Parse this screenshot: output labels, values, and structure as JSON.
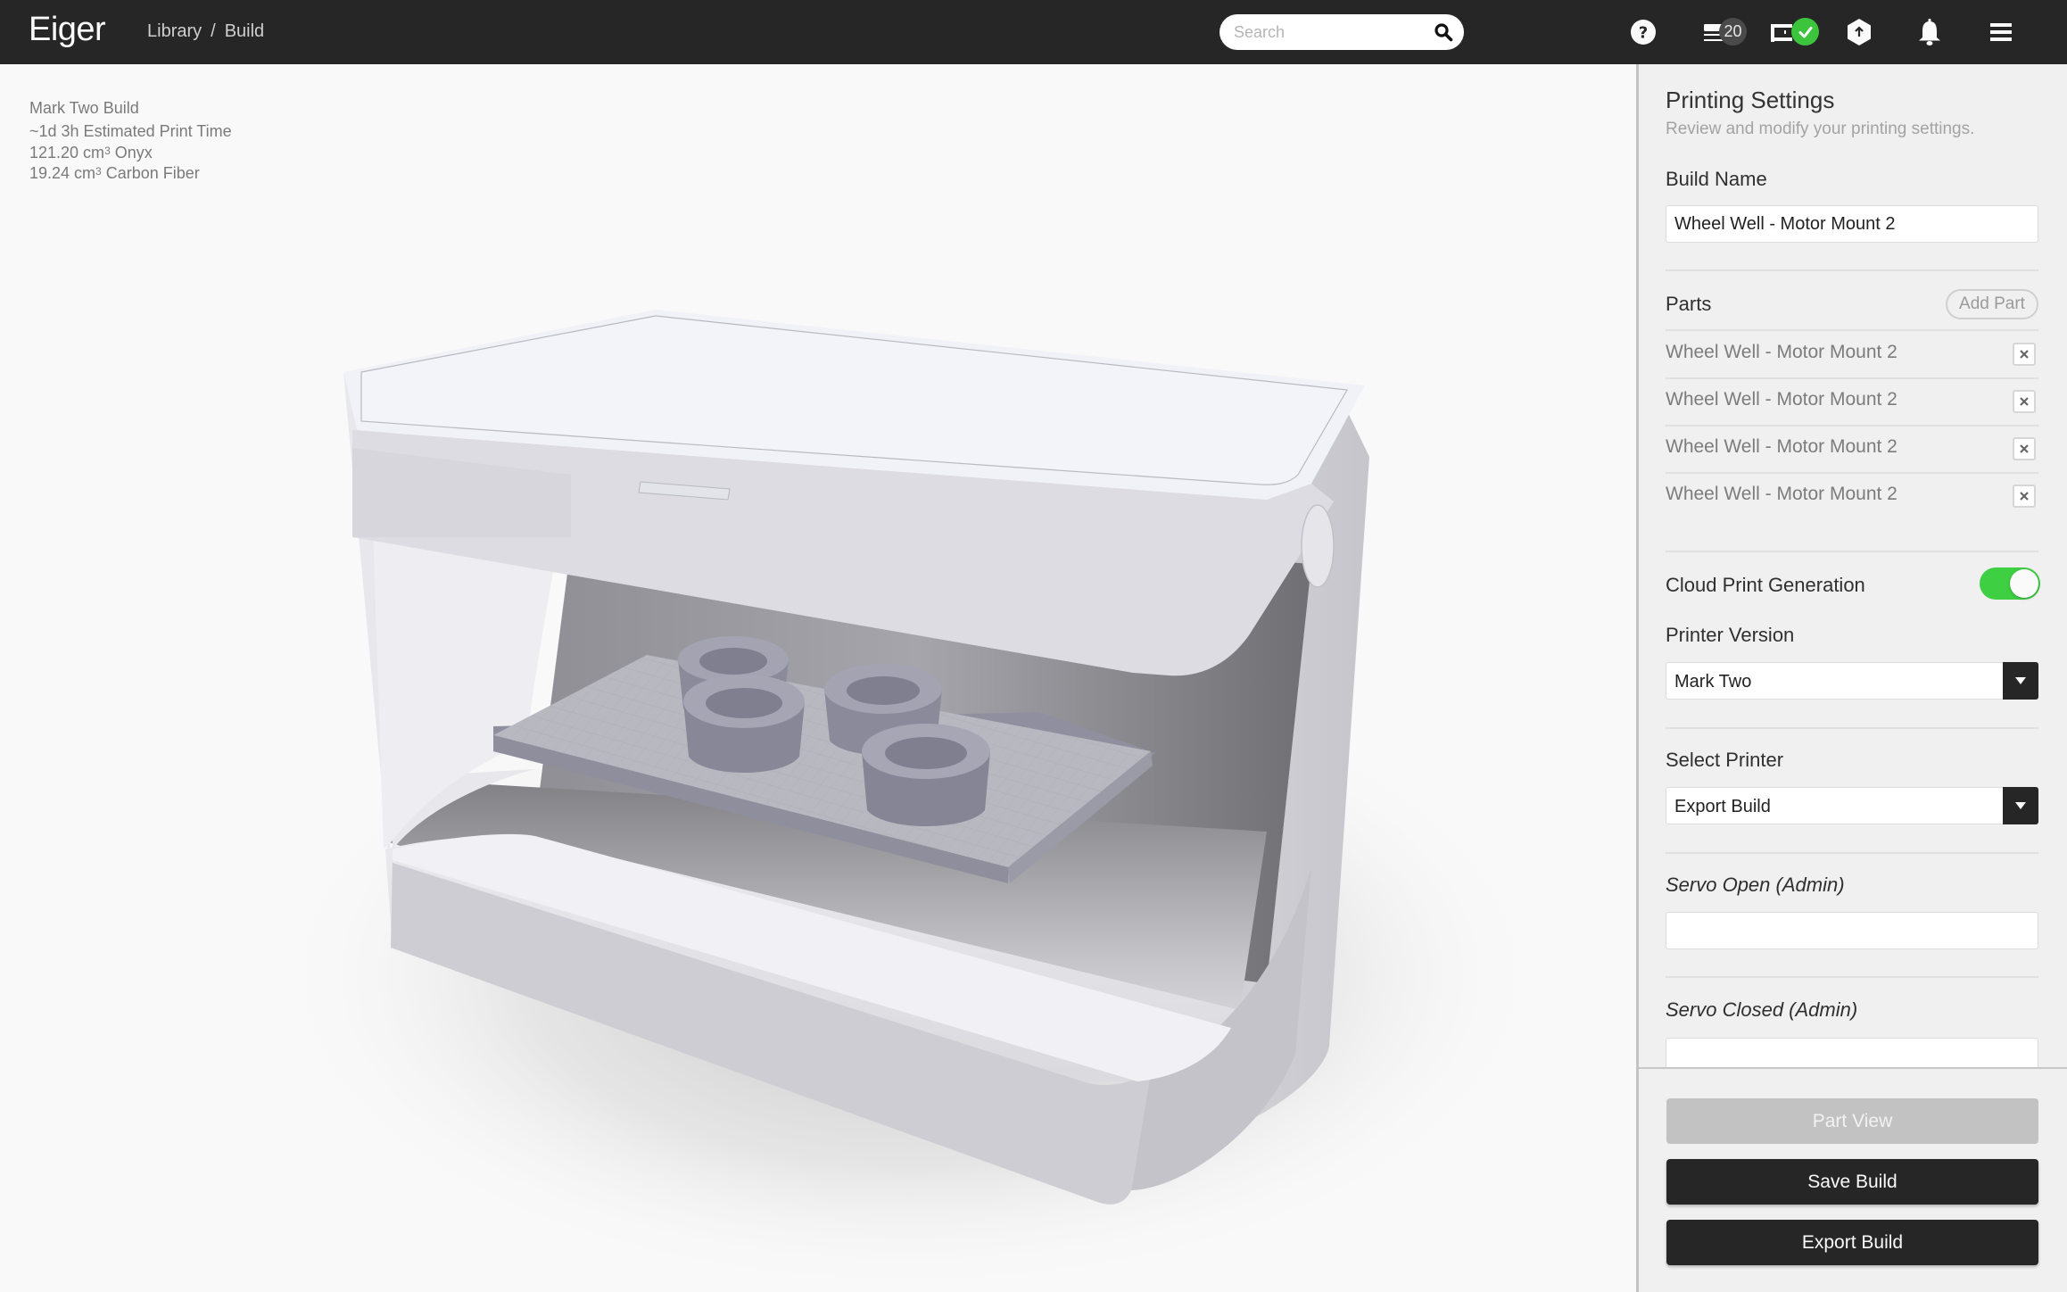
{
  "app": {
    "brand": "Eiger",
    "breadcrumb": [
      "Library",
      "Build"
    ],
    "breadcrumb_separator": "/"
  },
  "navbar": {
    "search": {
      "placeholder": "Search",
      "value": "",
      "icon": "search-icon"
    },
    "icons": [
      {
        "name": "help-icon",
        "label": "?"
      },
      {
        "name": "print-queue-icon",
        "badge": "20"
      },
      {
        "name": "printer-status-icon",
        "status": "ok"
      },
      {
        "name": "upload-icon"
      },
      {
        "name": "notifications-bell-icon"
      },
      {
        "name": "menu-icon"
      }
    ],
    "queue_count": "20"
  },
  "build_info": {
    "printer": "Mark Two Build",
    "print_time": "~1d 3h Estimated Print Time",
    "materials": [
      {
        "amount": "121.20 cm",
        "unit_sup": "3",
        "material": " Onyx"
      },
      {
        "amount": "19.24 cm",
        "unit_sup": "3",
        "material": " Carbon Fiber"
      }
    ]
  },
  "sidebar": {
    "title": "Printing Settings",
    "subtitle": "Review and modify your printing settings.",
    "build_name": {
      "label": "Build Name",
      "value": "Wheel Well - Motor Mount 2"
    },
    "parts": {
      "label": "Parts",
      "add_label": "Add Part",
      "items": [
        {
          "name": "Wheel Well - Motor Mount 2"
        },
        {
          "name": "Wheel Well - Motor Mount 2"
        },
        {
          "name": "Wheel Well - Motor Mount 2"
        },
        {
          "name": "Wheel Well - Motor Mount 2"
        }
      ]
    },
    "cloud_print": {
      "label": "Cloud Print Generation",
      "enabled": true
    },
    "printer_version": {
      "label": "Printer Version",
      "selected": "Mark Two"
    },
    "select_printer": {
      "label": "Select Printer",
      "selected": "Export Build"
    },
    "servo_open": {
      "label": "Servo Open (Admin)",
      "value": ""
    },
    "servo_closed": {
      "label": "Servo Closed (Admin)",
      "value": ""
    },
    "buttons": {
      "part_view": "Part View",
      "save": "Save Build",
      "export": "Export Build"
    }
  },
  "colors": {
    "navbar_bg": "#262626",
    "sidebar_bg": "#f0f0f0",
    "toggle_on": "#3ecf43",
    "status_ok": "#3cc43c",
    "primary_button": "#262626",
    "disabled_button": "#c2c2c2"
  }
}
